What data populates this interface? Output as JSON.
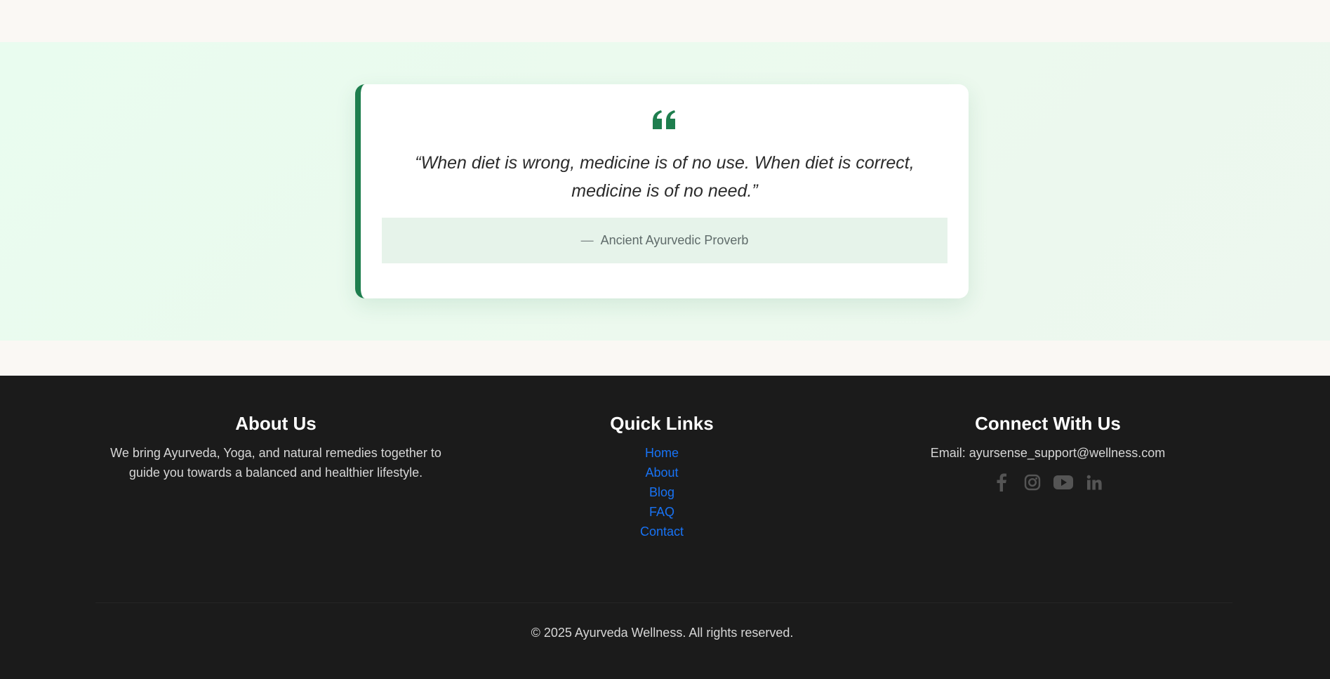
{
  "quote": {
    "text": "“When diet is wrong, medicine is of no use. When diet is correct, medicine is of no need.”",
    "author_dash": "—",
    "author": "Ancient Ayurvedic Proverb",
    "icon": "quote-left-icon",
    "accent_color": "#1e7e4e"
  },
  "footer": {
    "about": {
      "heading": "About Us",
      "body": "We bring Ayurveda, Yoga, and natural remedies together to guide you towards a balanced and healthier lifestyle."
    },
    "quick_links": {
      "heading": "Quick Links",
      "items": [
        {
          "label": "Home"
        },
        {
          "label": "About"
        },
        {
          "label": "Blog"
        },
        {
          "label": "FAQ"
        },
        {
          "label": "Contact"
        }
      ]
    },
    "connect": {
      "heading": "Connect With Us",
      "email": "Email: ayursense_support@wellness.com",
      "social": [
        {
          "icon": "facebook-icon"
        },
        {
          "icon": "instagram-icon"
        },
        {
          "icon": "youtube-icon"
        },
        {
          "icon": "linkedin-icon"
        }
      ]
    },
    "copyright": "© 2025 Ayurveda Wellness. All rights reserved.",
    "background_color": "#1b1b1b",
    "link_color": "#1873f5"
  }
}
